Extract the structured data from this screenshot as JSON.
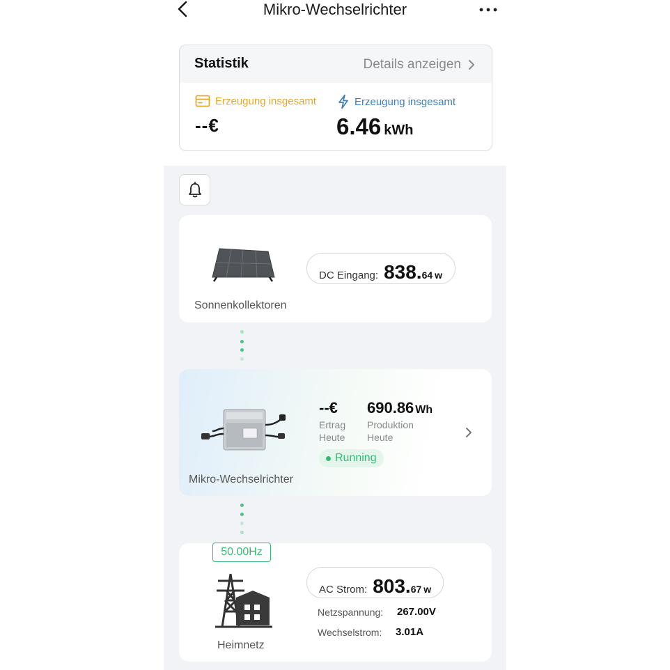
{
  "header": {
    "title": "Mikro-Wechselrichter",
    "back_icon": "chevron-left-icon",
    "more_icon": "more-horizontal-icon"
  },
  "stats": {
    "title": "Statistik",
    "details_link": "Details anzeigen",
    "money": {
      "label": "Erzeugung insgesamt",
      "value": "--€",
      "color": "#e8a72a",
      "icon": "wallet-icon"
    },
    "energy": {
      "label": "Erzeugung insgesamt",
      "value": "6.46",
      "unit": "kWh",
      "color": "#3f7fb8",
      "icon": "lightning-icon"
    }
  },
  "solar": {
    "caption": "Sonnenkollektoren",
    "dc_label": "DC Eingang",
    "dc_value_int": "838.",
    "dc_value_dec": "64",
    "dc_unit": "w"
  },
  "inverter": {
    "caption": "Mikro-Wechselrichter",
    "yield_value": "--€",
    "yield_label_1": "Ertrag",
    "yield_label_2": "Heute",
    "production_value": "690.86",
    "production_unit": "Wh",
    "production_label_1": "Produktion",
    "production_label_2": "Heute",
    "status": "Running",
    "status_color": "#33bb73"
  },
  "grid": {
    "caption": "Heimnetz",
    "frequency": "50.00Hz",
    "ac_label": "AC Strom",
    "ac_value_int": "803.",
    "ac_value_dec": "67",
    "ac_unit": "w",
    "voltage_label": "Netzspannung",
    "voltage_value": "267.00V",
    "current_label": "Wechselstrom",
    "current_value": "3.01A"
  },
  "colors": {
    "accent_green": "#33bb73",
    "money_orange": "#e8a72a",
    "energy_blue": "#3f7fb8"
  }
}
